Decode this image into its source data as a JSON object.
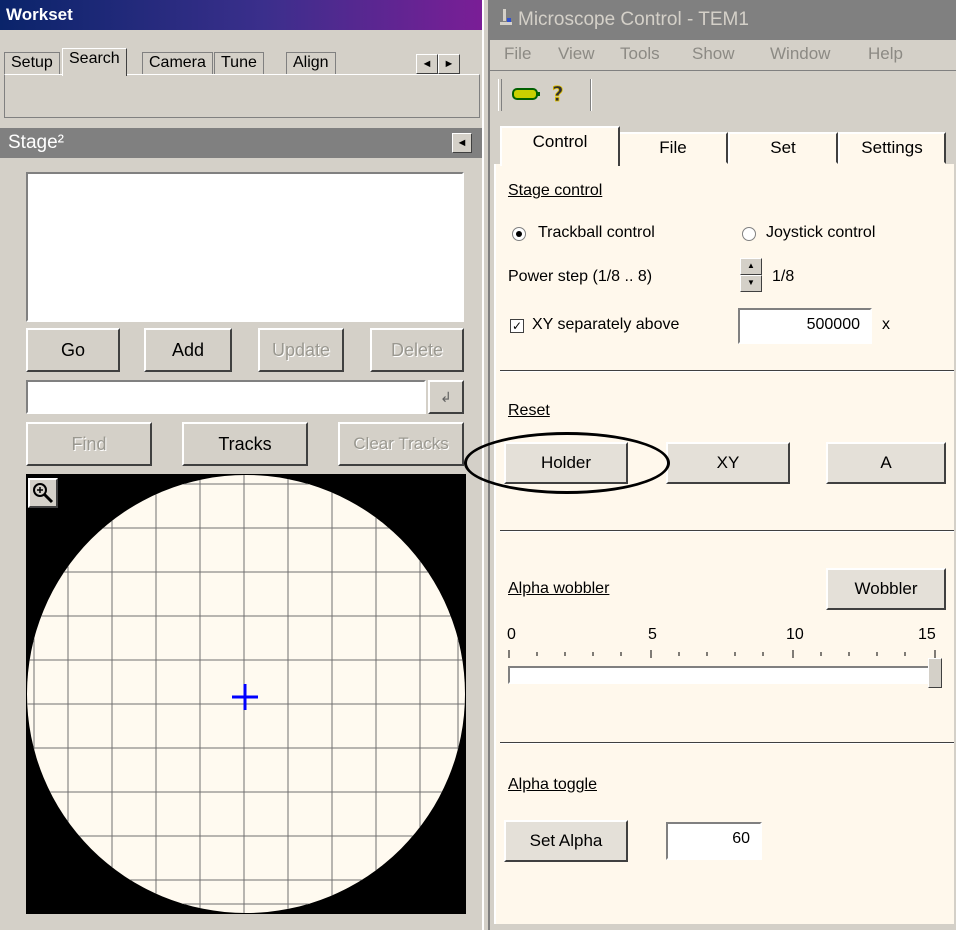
{
  "workset": {
    "title": "Workset",
    "tabs": [
      "Setup",
      "Search",
      "Camera",
      "Tune",
      "Align"
    ],
    "active_tab": "Search",
    "scroll_left": "◄",
    "scroll_right": "►"
  },
  "stage": {
    "title": "Stage²",
    "collapse": "◄",
    "buttons": {
      "go": "Go",
      "add": "Add",
      "update": "Update",
      "delete": "Delete",
      "find": "Find",
      "tracks": "Tracks",
      "clear_tracks": "Clear Tracks"
    },
    "enter_glyph": "↲",
    "zoom_glyph": "⊕"
  },
  "microscope": {
    "title": "Microscope Control - TEM1",
    "menu": [
      "File",
      "View",
      "Tools",
      "Show",
      "Window",
      "Help"
    ],
    "tabs": [
      "Control",
      "File",
      "Set",
      "Settings"
    ],
    "active_tab": "Control",
    "stage_control": {
      "label": "Stage control",
      "trackball": "Trackball control",
      "joystick": "Joystick control",
      "selected": "trackball",
      "power_step_label": "Power step (1/8 .. 8)",
      "power_step_value": "1/8",
      "xy_sep_label": "XY separately above",
      "xy_sep_checked": true,
      "xy_sep_value": "500000",
      "xy_sep_unit": "x"
    },
    "reset": {
      "label": "Reset",
      "holder": "Holder",
      "xy": "XY",
      "a": "A"
    },
    "alpha_wobbler": {
      "label": "Alpha wobbler",
      "button": "Wobbler",
      "ticks": [
        "0",
        "5",
        "10",
        "15"
      ],
      "value_fraction": 1.0
    },
    "alpha_toggle": {
      "label": "Alpha toggle",
      "button": "Set Alpha",
      "value": "60"
    }
  },
  "colors": {
    "panel_bg": "#fff8ec",
    "map_bg": "#fffaf0",
    "crosshair": "#0000ff"
  }
}
